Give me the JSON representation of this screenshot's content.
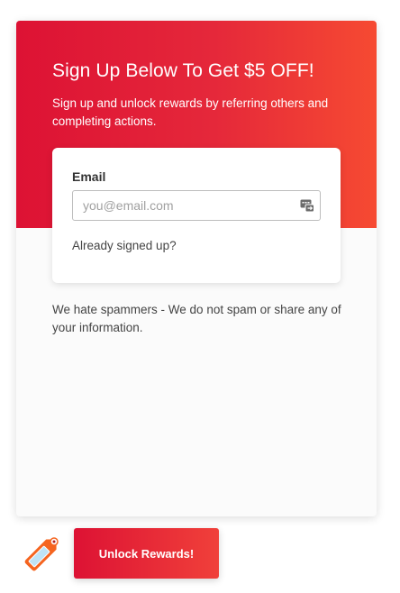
{
  "header": {
    "title": "Sign Up Below To Get $5 OFF!",
    "subtitle": "Sign up and unlock rewards by referring others and completing actions."
  },
  "signup_form": {
    "email_label": "Email",
    "email_placeholder": "you@email.com",
    "email_value": "",
    "already_signed_up": "Already signed up?"
  },
  "footer_note": "We hate spammers - We do not spam or share any of your information.",
  "launcher": {
    "icon": "price-tag-icon",
    "cta_label": "Unlock Rewards!"
  },
  "colors": {
    "accent_start": "#dd1234",
    "accent_end": "#f64a32"
  }
}
